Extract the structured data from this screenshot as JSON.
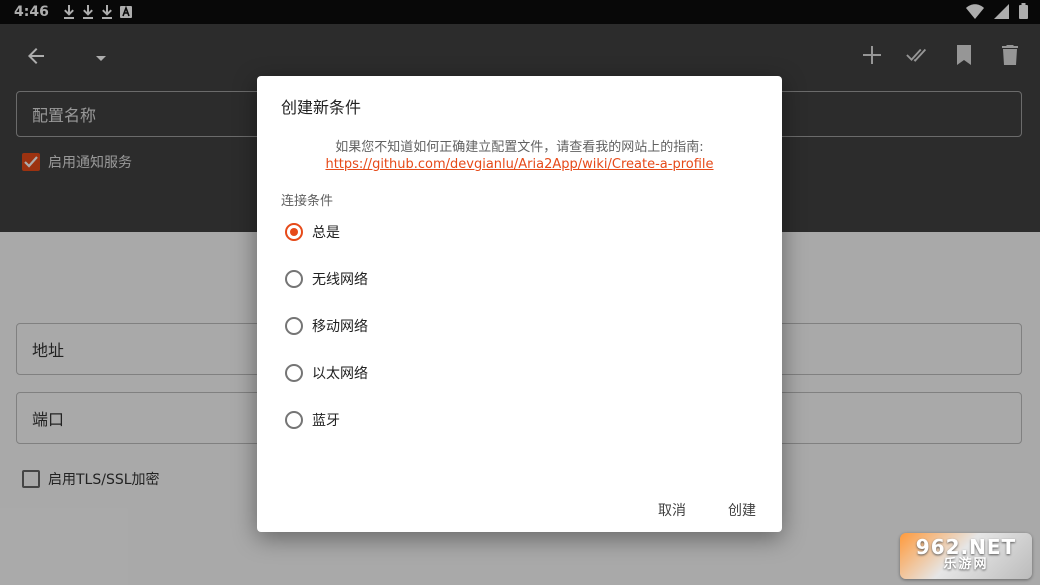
{
  "statusbar": {
    "time": "4:46"
  },
  "form": {
    "profile_name_placeholder": "配置名称",
    "enable_notifications_label": "启用通知服务",
    "address_placeholder": "地址",
    "port_placeholder": "端口",
    "tls_label": "启用TLS/SSL加密"
  },
  "dialog": {
    "title": "创建新条件",
    "info_text": "如果您不知道如何正确建立配置文件，请查看我的网站上的指南:",
    "info_link": "https://github.com/devgianlu/Aria2App/wiki/Create-a-profile",
    "section_label": "连接条件",
    "options": [
      "总是",
      "无线网络",
      "移动网络",
      "以太网络",
      "蓝牙"
    ],
    "selected_index": 0,
    "cancel_label": "取消",
    "create_label": "创建"
  },
  "watermark": {
    "top": "962.NET",
    "bottom": "乐游网"
  },
  "colors": {
    "accent": "#e64a19",
    "appbar": "#424242"
  }
}
